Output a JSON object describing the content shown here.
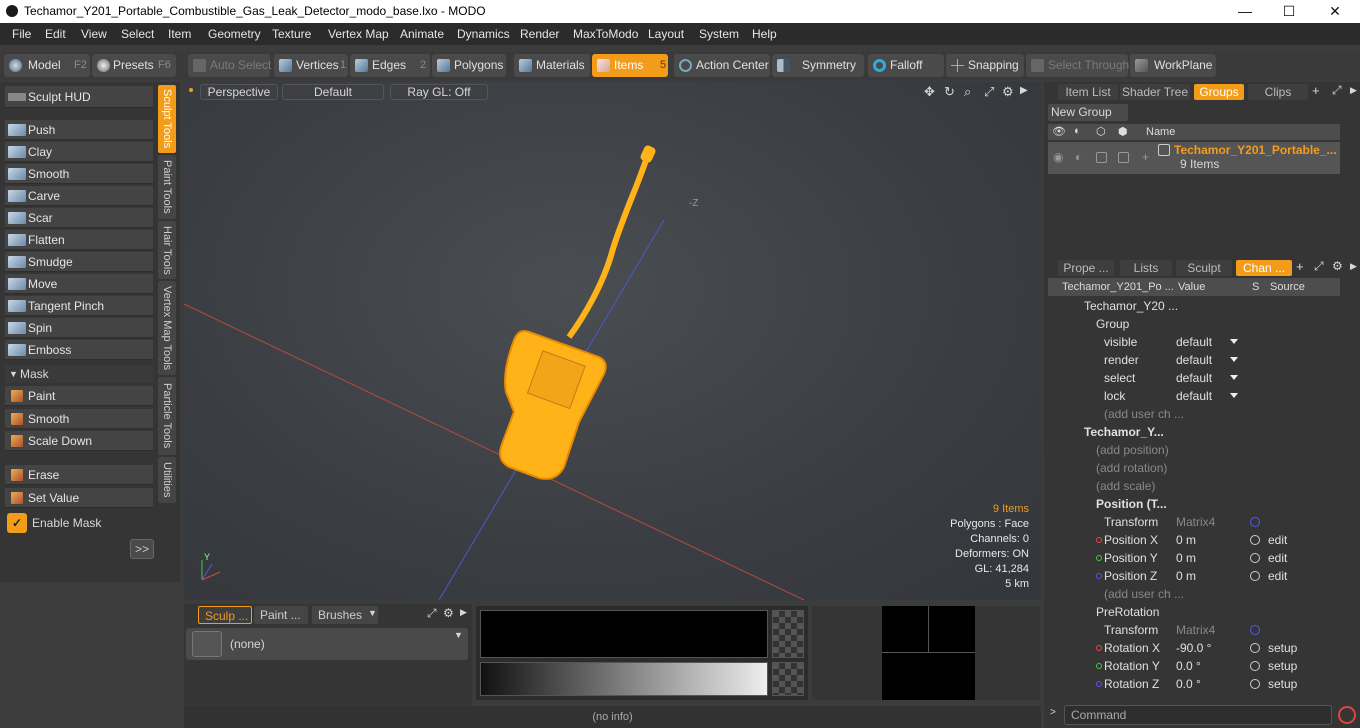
{
  "window": {
    "title": "Techamor_Y201_Portable_Combustible_Gas_Leak_Detector_modo_base.lxo - MODO",
    "minimize": "—",
    "maximize": "☐",
    "close": "✕"
  },
  "menu": [
    "File",
    "Edit",
    "View",
    "Select",
    "Item",
    "Geometry",
    "Texture",
    "Vertex Map",
    "Animate",
    "Dynamics",
    "Render",
    "MaxToModo",
    "Layout",
    "System",
    "Help"
  ],
  "toolbar": {
    "model": "Model",
    "model_key": "F2",
    "presets": "Presets",
    "presets_key": "F6",
    "auto_select": "Auto Select",
    "vertices": "Vertices",
    "vertices_key": "1",
    "edges": "Edges",
    "edges_key": "2",
    "polygons": "Polygons",
    "materials": "Materials",
    "items": "Items",
    "items_key": "5",
    "action_center": "Action Center",
    "symmetry": "Symmetry",
    "falloff": "Falloff",
    "snapping": "Snapping",
    "select_through": "Select Through",
    "workplane": "WorkPlane"
  },
  "left": {
    "sculpt_hud": "Sculpt HUD",
    "tools": [
      "Push",
      "Clay",
      "Smooth",
      "Carve",
      "Scar",
      "Flatten",
      "Smudge",
      "Move",
      "Tangent Pinch",
      "Spin",
      "Emboss"
    ],
    "mask_header": "Mask",
    "mask_tools": [
      "Paint",
      "Smooth",
      "Scale Down"
    ],
    "erase": "Erase",
    "set_value": "Set Value",
    "enable_mask": "Enable Mask",
    "expand": ">>",
    "vtabs": [
      "Sculpt Tools",
      "Paint Tools",
      "Hair Tools",
      "Vertex Map Tools",
      "Particle Tools",
      "Utilities"
    ]
  },
  "viewport": {
    "perspective": "Perspective",
    "default": "Default",
    "raygl": "Ray GL: Off",
    "axis_label": "-Z",
    "info": {
      "items": "9 Items",
      "polygons": "Polygons : Face",
      "channels": "Channels: 0",
      "deformers": "Deformers: ON",
      "gl": "GL: 41,284",
      "scale": "5 km"
    }
  },
  "bottom": {
    "tabs": [
      "Sculp ...",
      "Paint ...",
      "Brushes"
    ],
    "brush_value": "(none)",
    "status": "(no info)"
  },
  "right": {
    "top_tabs": [
      "Item List",
      "Shader Tree",
      "Groups",
      "Clips"
    ],
    "new_group": "New Group",
    "col_name": "Name",
    "group_name": "Techamor_Y201_Portable_...",
    "group_count": "9 Items",
    "chan_tabs": [
      "Prope ...",
      "Lists",
      "Sculpt",
      "Chan ..."
    ],
    "chan_cols": [
      "Techamor_Y201_Po ...",
      "Value",
      "S",
      "Source"
    ],
    "channels": [
      {
        "name": "Techamor_Y20 ...",
        "indent": 1,
        "value": "",
        "source": ""
      },
      {
        "name": "Group",
        "indent": 2,
        "value": "",
        "source": ""
      },
      {
        "name": "visible",
        "indent": 3,
        "value": "default",
        "source": ""
      },
      {
        "name": "render",
        "indent": 3,
        "value": "default",
        "source": ""
      },
      {
        "name": "select",
        "indent": 3,
        "value": "default",
        "source": ""
      },
      {
        "name": "lock",
        "indent": 3,
        "value": "default",
        "source": ""
      },
      {
        "name": "(add user ch ...",
        "indent": 3,
        "value": "",
        "source": ""
      },
      {
        "name": "Techamor_Y...",
        "indent": 1,
        "value": "",
        "source": ""
      },
      {
        "name": "(add position)",
        "indent": 2,
        "value": "",
        "source": ""
      },
      {
        "name": "(add rotation)",
        "indent": 2,
        "value": "",
        "source": ""
      },
      {
        "name": "(add scale)",
        "indent": 2,
        "value": "",
        "source": ""
      },
      {
        "name": "Position (T...",
        "indent": 2,
        "value": "",
        "source": ""
      },
      {
        "name": "Transform",
        "indent": 3,
        "value": "Matrix4",
        "source": ""
      },
      {
        "name": "Position X",
        "indent": 3,
        "value": "0 m",
        "source": "edit"
      },
      {
        "name": "Position Y",
        "indent": 3,
        "value": "0 m",
        "source": "edit"
      },
      {
        "name": "Position Z",
        "indent": 3,
        "value": "0 m",
        "source": "edit"
      },
      {
        "name": "(add user ch ...",
        "indent": 3,
        "value": "",
        "source": ""
      },
      {
        "name": "PreRotation",
        "indent": 2,
        "value": "",
        "source": ""
      },
      {
        "name": "Transform",
        "indent": 3,
        "value": "Matrix4",
        "source": ""
      },
      {
        "name": "Rotation X",
        "indent": 3,
        "value": "-90.0 °",
        "source": "setup"
      },
      {
        "name": "Rotation Y",
        "indent": 3,
        "value": "0.0 °",
        "source": "setup"
      },
      {
        "name": "Rotation Z",
        "indent": 3,
        "value": "0.0 °",
        "source": "setup"
      }
    ],
    "command": "Command"
  },
  "colors": {
    "accent": "#f39c1a",
    "object": "#ffb319"
  }
}
